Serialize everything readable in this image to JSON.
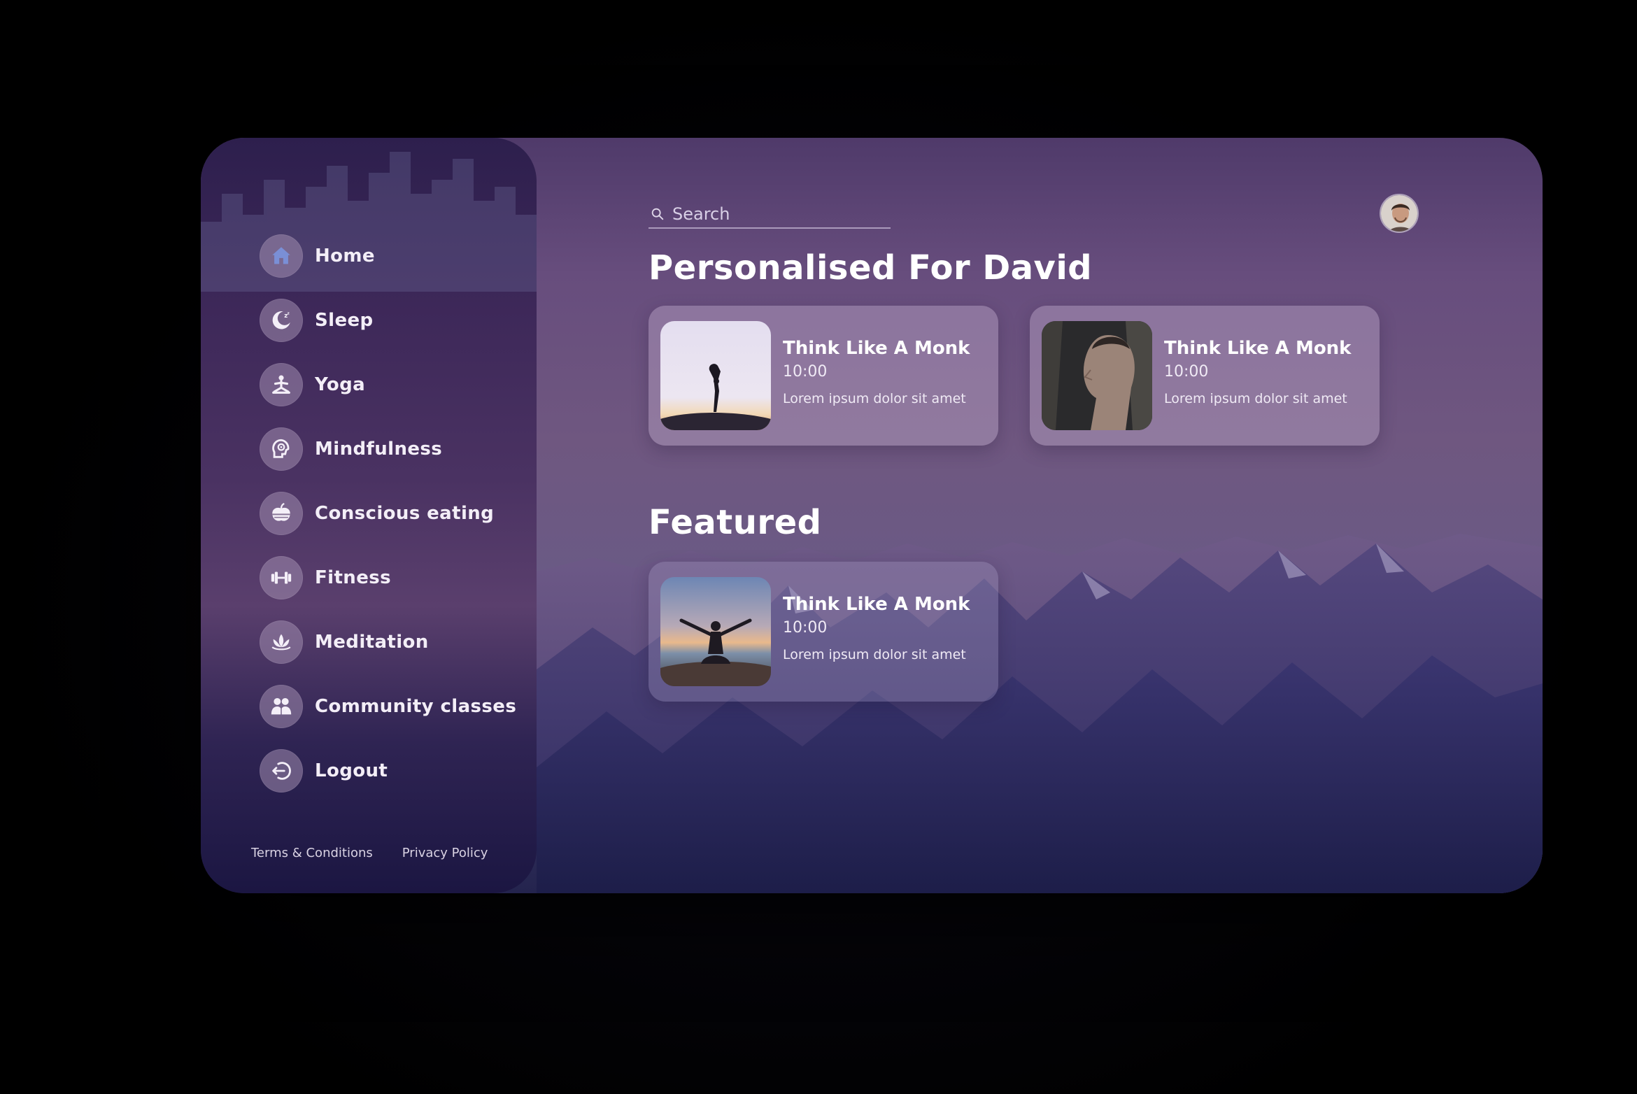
{
  "sidebar": {
    "items": [
      {
        "label": "Home",
        "icon": "home-icon"
      },
      {
        "label": "Sleep",
        "icon": "moon-icon"
      },
      {
        "label": "Yoga",
        "icon": "yoga-icon"
      },
      {
        "label": "Mindfulness",
        "icon": "mind-icon"
      },
      {
        "label": "Conscious eating",
        "icon": "food-icon"
      },
      {
        "label": "Fitness",
        "icon": "dumbbell-icon"
      },
      {
        "label": "Meditation",
        "icon": "lotus-icon"
      },
      {
        "label": "Community classes",
        "icon": "people-icon"
      },
      {
        "label": "Logout",
        "icon": "logout-icon"
      }
    ],
    "footer": {
      "terms": "Terms & Conditions",
      "privacy": "Privacy Policy"
    }
  },
  "header": {
    "search_placeholder": "Search"
  },
  "personalised": {
    "title": "Personalised For David",
    "cards": [
      {
        "title": "Think Like A Monk",
        "time": "10:00",
        "description": "Lorem ipsum dolor sit amet"
      },
      {
        "title": "Think Like A Monk",
        "time": "10:00",
        "description": "Lorem ipsum dolor sit amet"
      }
    ]
  },
  "featured": {
    "title": "Featured",
    "cards": [
      {
        "title": "Think Like A Monk",
        "time": "10:00",
        "description": "Lorem ipsum dolor sit amet"
      }
    ]
  },
  "colors": {
    "accent": "#6f5780",
    "sidebar_dark": "#1b1642",
    "home_icon": "#7a8fd6"
  }
}
